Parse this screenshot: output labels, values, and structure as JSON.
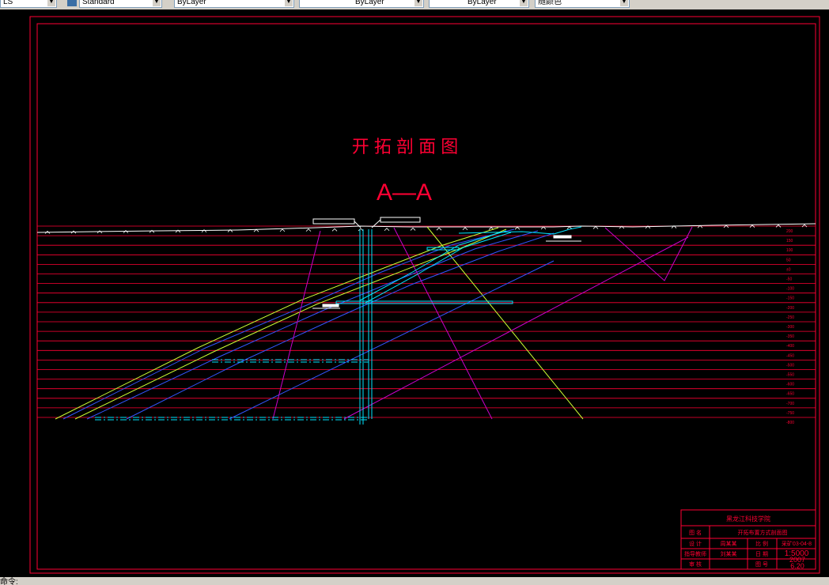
{
  "toolbar": {
    "combo_left": "LS",
    "text_style": "Standard",
    "layer": "ByLayer",
    "linetype": "ByLayer",
    "lineweight": "ByLayer",
    "plot_style": "随颜色"
  },
  "drawing": {
    "title": "开 拓 剖 面 图",
    "section": "A—A",
    "elevations": [
      "200",
      "150",
      "100",
      "50",
      "±0",
      "-50",
      "-100",
      "-150",
      "-200",
      "-250",
      "-300",
      "-350",
      "-400",
      "-450",
      "-500",
      "-550",
      "-600",
      "-650",
      "-700",
      "-750",
      "-800"
    ],
    "title_block": {
      "organization": "黑龙江科技学院",
      "drawing_name": "开拓布置方式剖面图",
      "row1_left_label": "图 名",
      "row2_left_label": "设 计",
      "row2_left_value": "周某某",
      "row2_mid_label": "比 例",
      "row2_right_value": "1:5000",
      "row2_code": "采矿03-04-8",
      "row3_left_label": "指导教师",
      "row3_left_value": "刘某某",
      "row3_mid_label": "日 期",
      "row3_right_value": "2007",
      "row4_left_label": "审 核",
      "row4_mid_label": "图 号",
      "row4_right_value": "6.20"
    },
    "colors": {
      "frame": "#ff0033",
      "text": "#ff0033",
      "surface": "#ffffff",
      "coal_seam": "#ccff33",
      "rock": "#3355ff",
      "fault": "#cc00cc",
      "shaft": "#00e5ff"
    }
  },
  "status": {
    "text": "命令:"
  }
}
